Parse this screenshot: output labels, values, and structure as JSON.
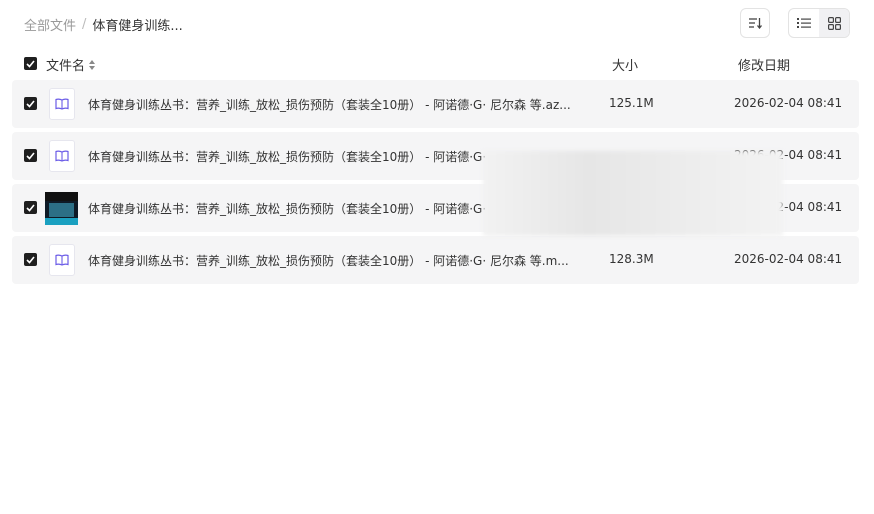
{
  "breadcrumb": {
    "root": "全部文件",
    "separator": "/",
    "current": "体育健身训练..."
  },
  "toolbar": {
    "sort_icon": "sort-icon",
    "list_icon": "list-view-icon",
    "grid_icon": "grid-view-icon"
  },
  "table": {
    "headers": {
      "name": "文件名",
      "size": "大小",
      "date": "修改日期"
    },
    "rows": [
      {
        "name": "体育健身训练丛书：营养_训练_放松_损伤预防（套装全10册） - 阿诺德·G· 尼尔森 等.az...",
        "size": "125.1M",
        "date": "2026-02-04 08:41",
        "icon": "ebook-icon"
      },
      {
        "name": "体育健身训练丛书：营养_训练_放松_损伤预防（套装全10册） - 阿诺德·G·",
        "size": "",
        "date": "2026-02-04 08:41",
        "icon": "ebook-icon"
      },
      {
        "name": "体育健身训练丛书：营养_训练_放松_损伤预防（套装全10册） - 阿诺德·G·",
        "size": "",
        "date": "2026-02-04 08:41",
        "icon": "cover-thumbnail"
      },
      {
        "name": "体育健身训练丛书：营养_训练_放松_损伤预防（套装全10册） - 阿诺德·G· 尼尔森 等.m...",
        "size": "128.3M",
        "date": "2026-02-04 08:41",
        "icon": "ebook-icon"
      }
    ]
  },
  "colors": {
    "row_bg": "#f5f5f6",
    "icon_accent": "#6b5ce7",
    "checkbox": "#1f1f1f"
  }
}
